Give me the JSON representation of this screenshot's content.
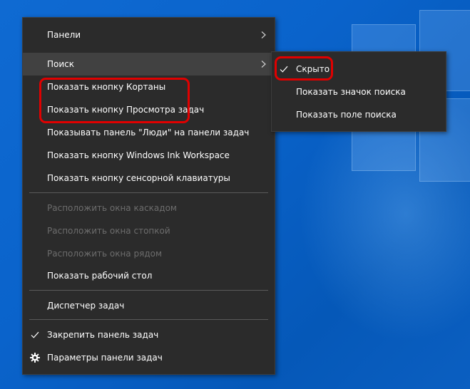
{
  "context_menu": {
    "items": [
      {
        "label": "Панели"
      },
      {
        "label": "Поиск"
      },
      {
        "label": "Показать кнопку Кортаны"
      },
      {
        "label": "Показать кнопку Просмотра задач"
      },
      {
        "label": "Показывать панель \"Люди\" на панели задач"
      },
      {
        "label": "Показать кнопку Windows Ink Workspace"
      },
      {
        "label": "Показать кнопку сенсорной клавиатуры"
      },
      {
        "label": "Расположить окна каскадом"
      },
      {
        "label": "Расположить окна стопкой"
      },
      {
        "label": "Расположить окна рядом"
      },
      {
        "label": "Показать рабочий стол"
      },
      {
        "label": "Диспетчер задач"
      },
      {
        "label": "Закрепить панель задач"
      },
      {
        "label": "Параметры панели задач"
      }
    ]
  },
  "search_submenu": {
    "items": [
      {
        "label": "Скрыто"
      },
      {
        "label": "Показать значок поиска"
      },
      {
        "label": "Показать поле поиска"
      }
    ]
  },
  "colors": {
    "menu_background": "#2b2b2b",
    "highlight_outline": "#e00000",
    "desktop_background": "#0a63c9"
  }
}
